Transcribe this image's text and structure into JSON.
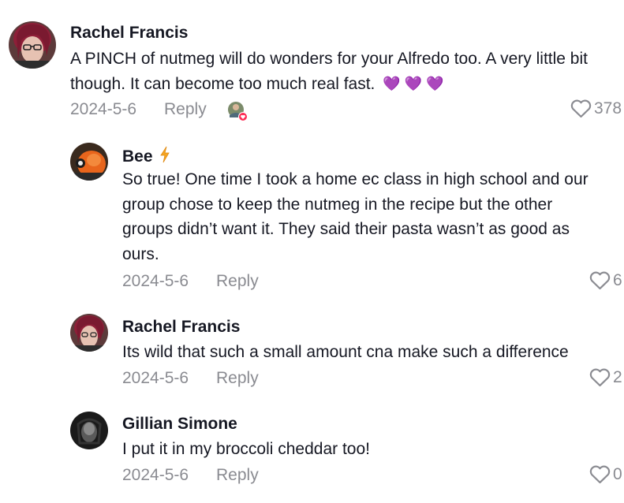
{
  "comments": [
    {
      "username": "Rachel Francis",
      "text_line1": "A PINCH of nutmeg will do wonders for your Alfredo too. A very little bit",
      "text_line2": "though. It can become too much real fast.",
      "emojis": "💜 💜 💜",
      "date": "2024-5-6",
      "reply_label": "Reply",
      "likes": "378"
    },
    {
      "username": "Bee",
      "lines": [
        "So true! One time I took a home ec class in high school and our",
        "group chose to keep the nutmeg in the recipe but the other",
        "groups didn’t want it. They said their pasta wasn’t as good as",
        "ours."
      ],
      "date": "2024-5-6",
      "reply_label": "Reply",
      "likes": "6"
    },
    {
      "username": "Rachel Francis",
      "text": "Its wild that such a small amount cna make such a difference",
      "date": "2024-5-6",
      "reply_label": "Reply",
      "likes": "2"
    },
    {
      "username": "Gillian Simone",
      "text": "I put it in my broccoli cheddar too!",
      "date": "2024-5-6",
      "reply_label": "Reply",
      "likes": "0"
    }
  ],
  "colors": {
    "text": "#161823",
    "muted": "#8a8b91",
    "heart_emoji": "#8b3fd9",
    "bolt": "#f5a623",
    "reaction_badge": "#fe2c55"
  },
  "icons": [
    "heart-outline-icon",
    "lightning-bolt-icon",
    "purple-heart-emoji",
    "creator-liked-reaction-icon"
  ]
}
